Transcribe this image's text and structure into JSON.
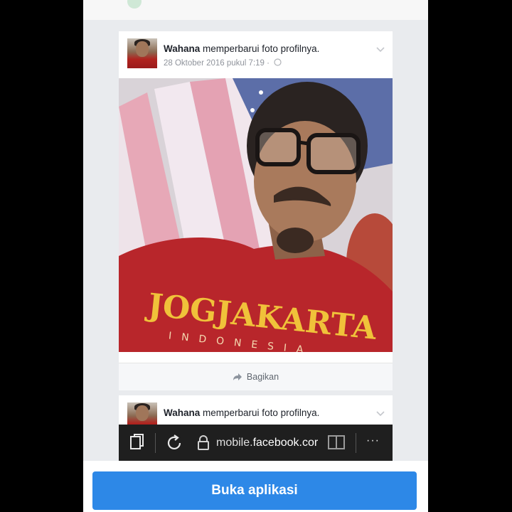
{
  "posts": [
    {
      "author": "Wahana",
      "action": "memperbarui foto profilnya.",
      "timestamp": "28 Oktober 2016 pukul 7:19 ·",
      "photo_shirt_text": "JOGJAKARTA",
      "photo_shirt_subtext": "INDONESIA",
      "share_label": "Bagikan"
    },
    {
      "author": "Wahana",
      "action": "memperbarui foto profilnya."
    }
  ],
  "browser": {
    "url_prefix": "mobile.",
    "url_domain": "facebook.cor",
    "more": "···"
  },
  "open_app_button": "Buka aplikasi",
  "colors": {
    "button_blue": "#2d88e7",
    "browser_bar": "#1f1f1f",
    "shirt_red": "#b8262b",
    "shirt_text_yellow": "#f0c23a"
  }
}
